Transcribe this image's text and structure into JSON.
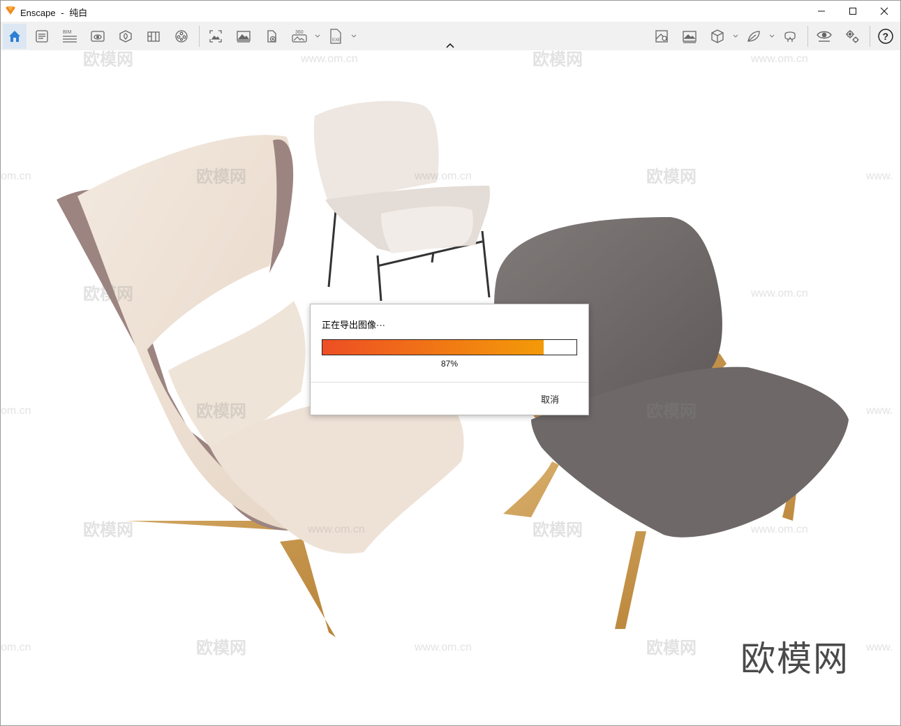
{
  "window": {
    "app_name": "Enscape",
    "separator": "-",
    "document_name": "纯白"
  },
  "toolbar": {
    "left_tools": [
      {
        "name": "home-icon",
        "active": true
      },
      {
        "name": "asset-library-icon"
      },
      {
        "name": "bim-icon",
        "text": "BIM"
      },
      {
        "name": "view-management-icon"
      },
      {
        "name": "site-context-icon"
      },
      {
        "name": "material-editor-icon"
      },
      {
        "name": "video-editor-icon"
      },
      {
        "name": "render-screenshot-icon"
      },
      {
        "name": "batch-render-icon"
      },
      {
        "name": "export-panorama-icon"
      },
      {
        "name": "panorama-360-icon",
        "text": "360"
      },
      {
        "name": "export-exe-icon",
        "text": "EXE"
      }
    ],
    "right_tools": [
      {
        "name": "atmosphere-icon"
      },
      {
        "name": "visual-settings-icon"
      },
      {
        "name": "cube-view-icon"
      },
      {
        "name": "vegetation-icon"
      },
      {
        "name": "vr-headset-icon"
      },
      {
        "name": "visibility-icon"
      },
      {
        "name": "settings-icon"
      },
      {
        "name": "help-icon",
        "text": "?"
      }
    ]
  },
  "watermarks": {
    "site_text": "www.om.cn",
    "brand_text": "欧模网",
    "brand_large": "欧模网",
    "partial_left": "om.cn",
    "partial_right": "www."
  },
  "export_dialog": {
    "title": "正在导出图像···",
    "progress_percent": 87,
    "progress_label": "87%",
    "cancel_label": "取消",
    "progress_colors": [
      "#ee4e24",
      "#f39b08"
    ]
  }
}
